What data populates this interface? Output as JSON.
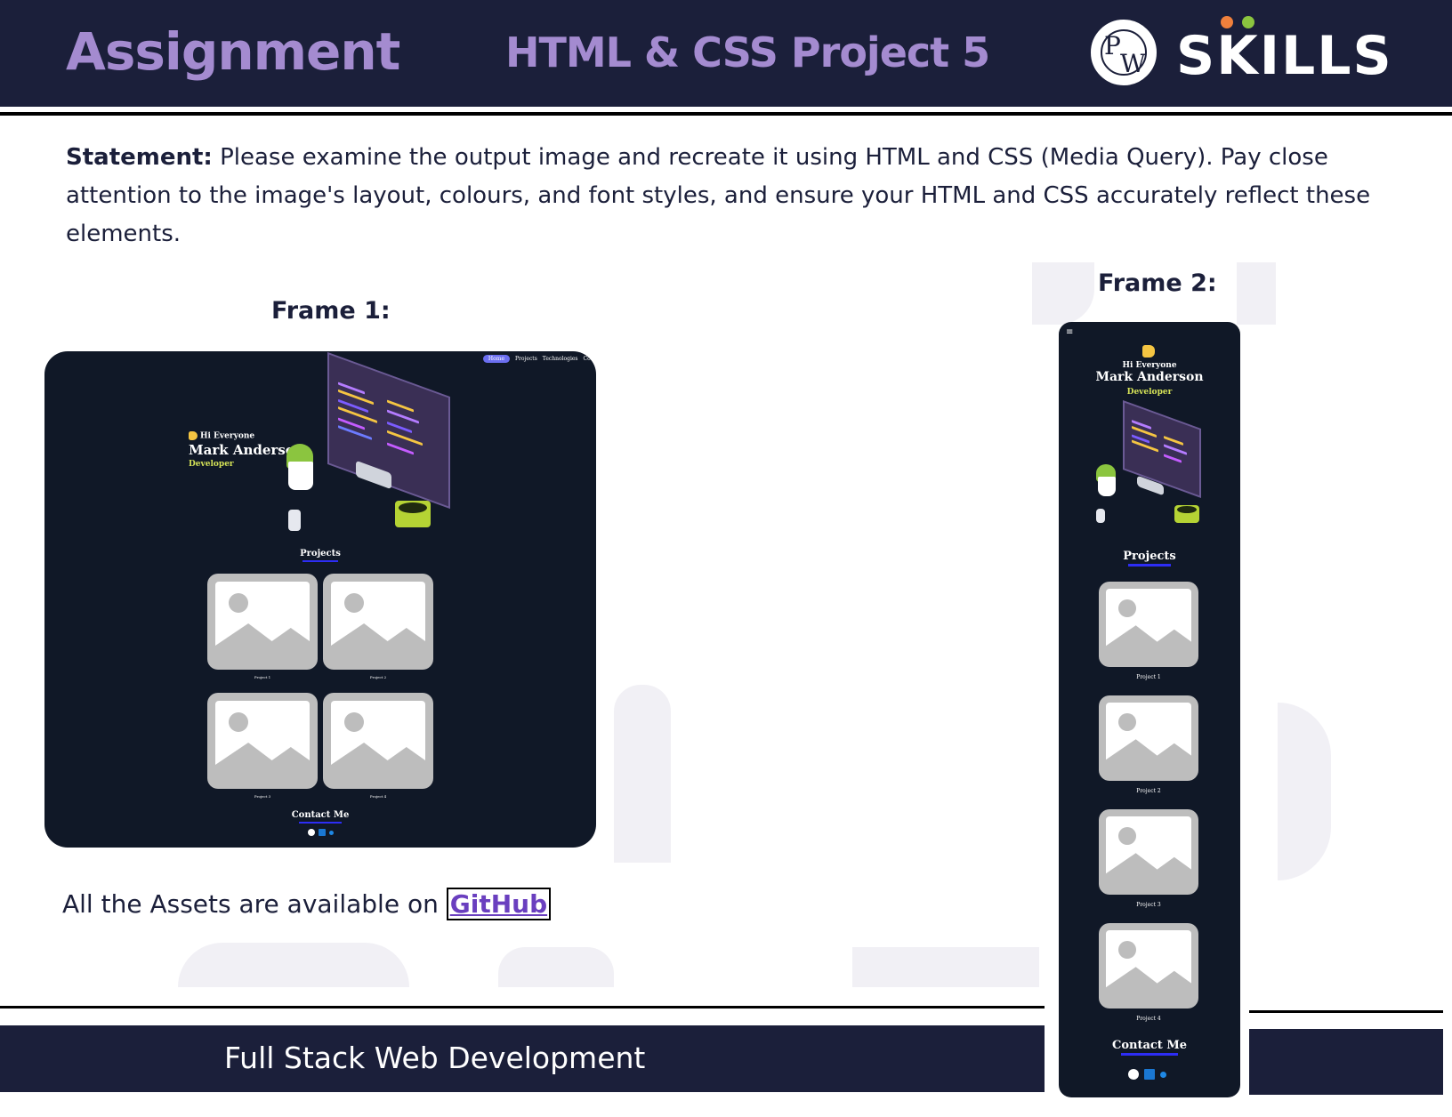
{
  "header": {
    "left_title": "Assignment",
    "center_title": "HTML & CSS Project 5",
    "logo_text": "SKILLS",
    "logo_monogram_p": "P",
    "logo_monogram_w": "W"
  },
  "statement": {
    "label": "Statement:",
    "text": " Please examine the output image and recreate it using HTML and CSS (Media Query). Pay close attention to the image's layout, colours, and font styles, and ensure your HTML and CSS accurately reflect these elements."
  },
  "frame1": {
    "title": "Frame 1:",
    "nav": [
      "Home",
      "Projects",
      "Technologies",
      "Cont"
    ],
    "hero": {
      "greeting": "Hi Everyone",
      "name": "Mark Anderson",
      "role": "Developer"
    },
    "projects_title": "Projects",
    "projects": [
      "Project 1",
      "Project 2",
      "Project 3",
      "Project 4"
    ],
    "contact_title": "Contact Me"
  },
  "frame2": {
    "title": "Frame 2:",
    "menu_icon": "≡",
    "hero": {
      "greeting": "Hi Everyone",
      "name": "Mark Anderson",
      "role": "Developer"
    },
    "projects_title": "Projects",
    "projects": [
      "Project 1",
      "Project 2",
      "Project 3",
      "Project 4"
    ],
    "contact_title": "Contact Me"
  },
  "assets": {
    "text": "All the Assets are available on ",
    "link": "GitHub"
  },
  "footer": {
    "text": "Full Stack Web Development"
  },
  "colors": {
    "brand_dark": "#1b1f3a",
    "accent_purple": "#a48bd0",
    "frame_bg": "#101827",
    "developer_yellow": "#d4e157"
  }
}
